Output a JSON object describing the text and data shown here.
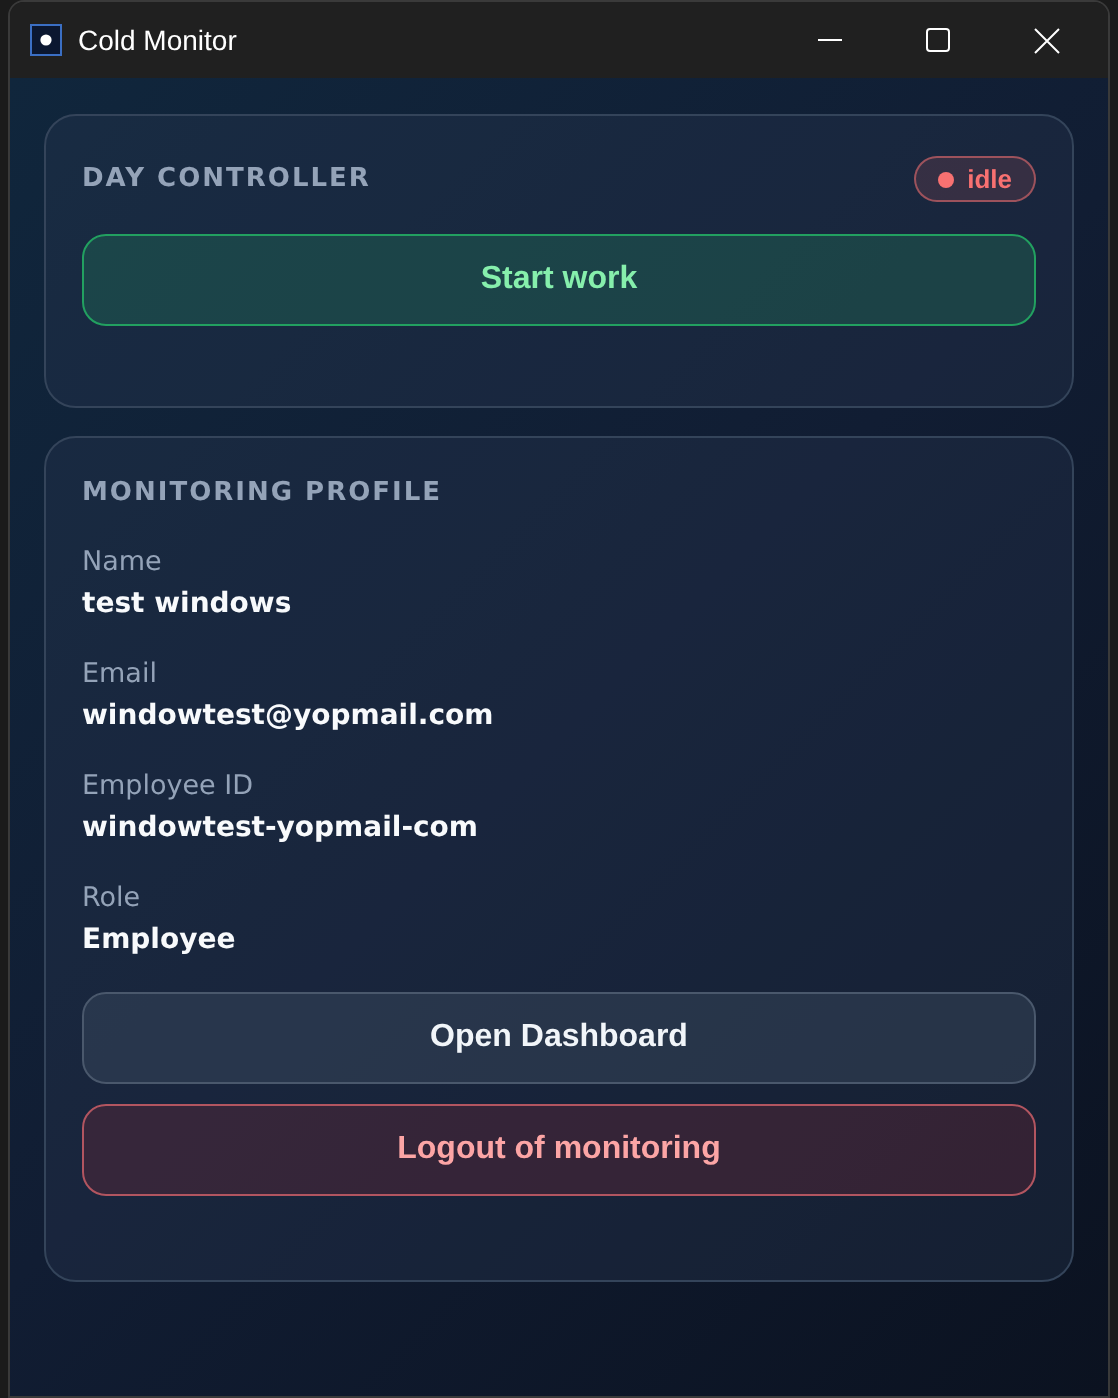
{
  "window": {
    "title": "Cold Monitor"
  },
  "day_controller": {
    "title": "DAY CONTROLLER",
    "status": {
      "label": "idle",
      "kind": "idle"
    },
    "button": {
      "label": "Start work",
      "kind": "start"
    }
  },
  "profile": {
    "title": "MONITORING PROFILE",
    "fields": [
      {
        "label": "Name",
        "value": "test windows"
      },
      {
        "label": "Email",
        "value": "windowtest@yopmail.com"
      },
      {
        "label": "Employee ID",
        "value": "windowtest-yopmail-com"
      },
      {
        "label": "Role",
        "value": "Employee"
      }
    ],
    "buttons": [
      {
        "label": "Open Dashboard",
        "kind": "secondary"
      },
      {
        "label": "Logout of monitoring",
        "kind": "danger"
      }
    ]
  }
}
